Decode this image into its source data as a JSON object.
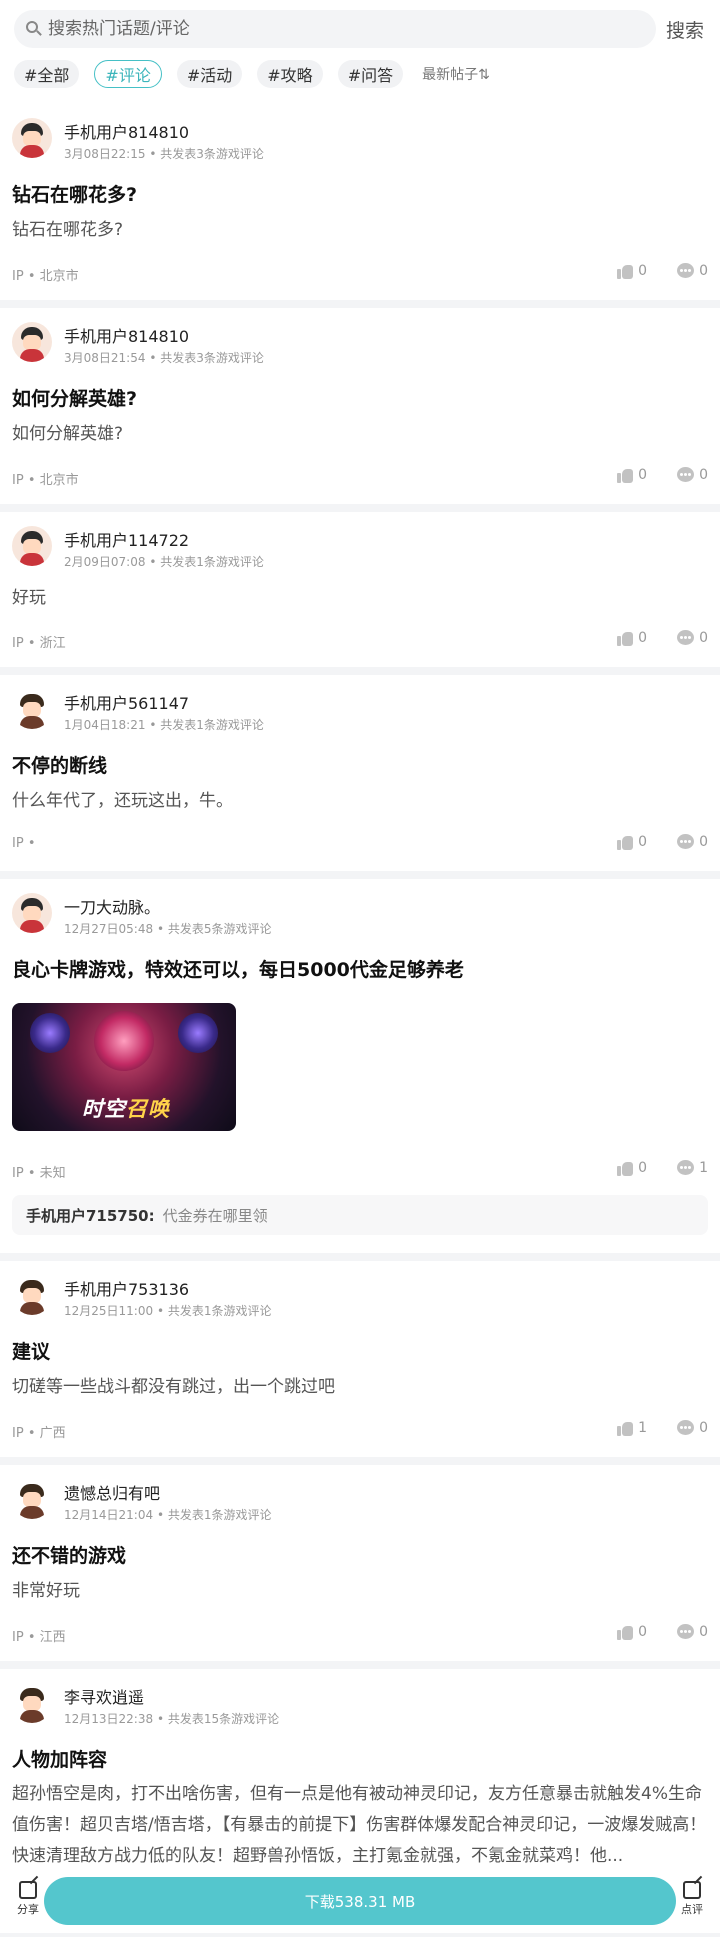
{
  "search": {
    "placeholder": "搜索热门话题/评论",
    "button_label": "搜索"
  },
  "tags": [
    {
      "label": "#全部",
      "active": false
    },
    {
      "label": "#评论",
      "active": true
    },
    {
      "label": "#活动",
      "active": false
    },
    {
      "label": "#攻略",
      "active": false
    },
    {
      "label": "#问答",
      "active": false
    }
  ],
  "sort_label": "最新帖子⇅",
  "posts": [
    {
      "username": "手机用户814810",
      "date": "3月08日22:15",
      "count_text": "共发表3条游戏评论",
      "title": "钻石在哪花多?",
      "content": "钻石在哪花多?",
      "ip": "北京市",
      "likes": "0",
      "comments": "0"
    },
    {
      "username": "手机用户814810",
      "date": "3月08日21:54",
      "count_text": "共发表3条游戏评论",
      "title": "如何分解英雄?",
      "content": "如何分解英雄?",
      "ip": "北京市",
      "likes": "0",
      "comments": "0"
    },
    {
      "username": "手机用户114722",
      "date": "2月09日07:08",
      "count_text": "共发表1条游戏评论",
      "title": "",
      "content": "好玩",
      "ip": "浙江",
      "likes": "0",
      "comments": "0"
    },
    {
      "username": "手机用户561147",
      "date": "1月04日18:21",
      "count_text": "共发表1条游戏评论",
      "title": "不停的断线",
      "content": "什么年代了，还玩这出，牛。",
      "ip": "",
      "likes": "0",
      "comments": "0"
    },
    {
      "username": "一刀大动脉。",
      "date": "12月27日05:48",
      "count_text": "共发表5条游戏评论",
      "title": "良心卡牌游戏，特效还可以，每日5000代金足够养老",
      "content": "",
      "image_caption": "时空召唤",
      "ip": "未知",
      "likes": "0",
      "comments": "1",
      "reply": {
        "user": "手机用户715750:",
        "text": "代金券在哪里领"
      }
    },
    {
      "username": "手机用户753136",
      "date": "12月25日11:00",
      "count_text": "共发表1条游戏评论",
      "title": "建议",
      "content": "切磋等一些战斗都没有跳过，出一个跳过吧",
      "ip": "广西",
      "likes": "1",
      "comments": "0"
    },
    {
      "username": "遗憾总归有吧",
      "date": "12月14日21:04",
      "count_text": "共发表1条游戏评论",
      "title": "还不错的游戏",
      "content": "非常好玩",
      "ip": "江西",
      "likes": "0",
      "comments": "0"
    },
    {
      "username": "李寻欢逍遥",
      "date": "12月13日22:38",
      "count_text": "共发表15条游戏评论",
      "title": "人物加阵容",
      "content": "超孙悟空是肉，打不出啥伤害，但有一点是他有被动神灵印记，友方任意暴击就触发4%生命值伤害！超贝吉塔/悟吉塔，【有暴击的前提下】伤害群体爆发配合神灵印记，一波爆发贼高！快速清理敌方战力低的队友！超野兽孙悟饭，主打氪金就强，不氪金就菜鸡！他...",
      "ip": "",
      "likes": "",
      "comments": ""
    }
  ],
  "ip_prefix": "IP",
  "bottom": {
    "share_label": "分享",
    "download_label": "下载538.31 MB",
    "review_label": "点评"
  }
}
